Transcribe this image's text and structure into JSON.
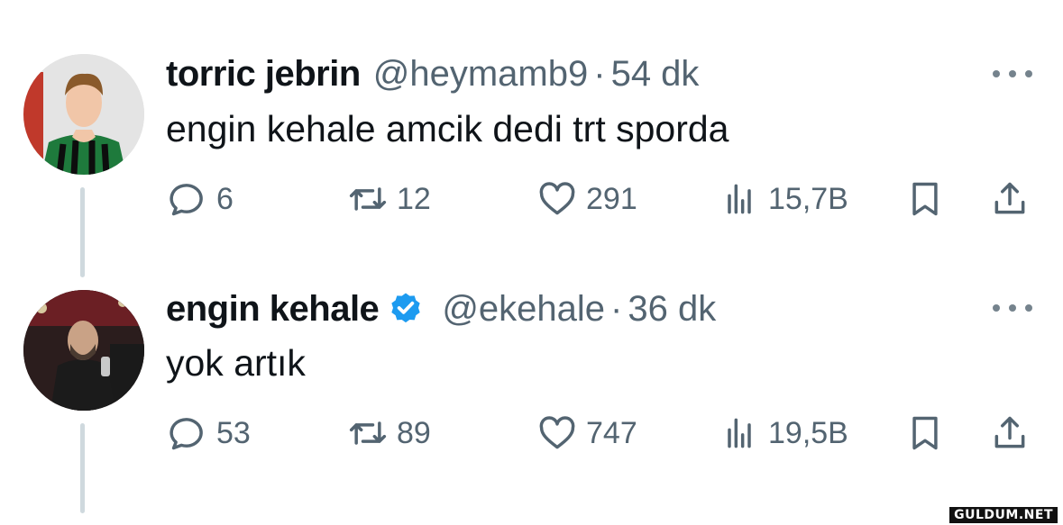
{
  "tweets": [
    {
      "author_name": "torric jebrin",
      "handle": "@heymamb9",
      "separator": "·",
      "time": "54 dk",
      "text": "engin kehale amcik dedi trt sporda",
      "verified": false,
      "stats": {
        "replies": "6",
        "retweets": "12",
        "likes": "291",
        "views": "15,7B"
      }
    },
    {
      "author_name": "engin kehale",
      "handle": "@ekehale",
      "separator": "·",
      "time": "36 dk",
      "text": "yok artık",
      "verified": true,
      "stats": {
        "replies": "53",
        "retweets": "89",
        "likes": "747",
        "views": "19,5B"
      }
    }
  ],
  "watermark": "GULDUM.NET",
  "colors": {
    "text": "#0f1419",
    "secondary": "#536471",
    "verified": "#1d9bf0",
    "thread_line": "#cfd9de"
  }
}
